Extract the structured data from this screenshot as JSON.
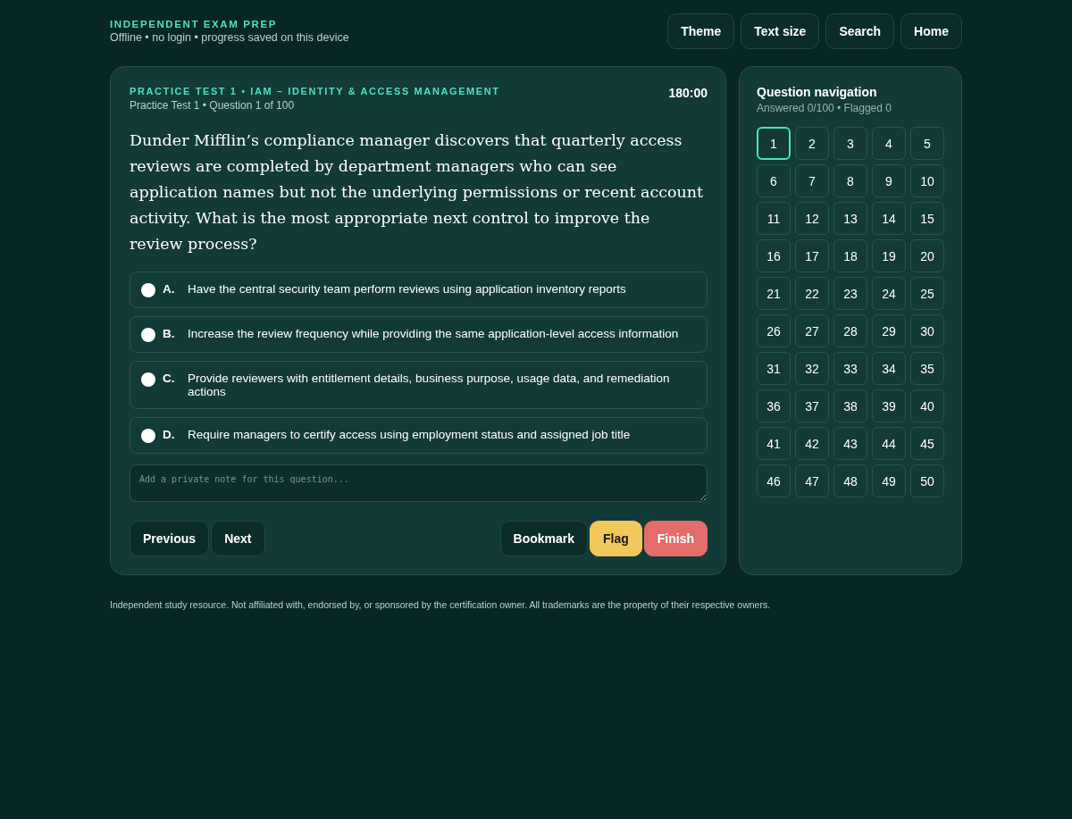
{
  "header": {
    "brand": "INDEPENDENT EXAM PREP",
    "tagline": "Offline • no login • progress saved on this device",
    "buttons": [
      "Theme",
      "Text size",
      "Search",
      "Home"
    ]
  },
  "question_card": {
    "eyebrow": "PRACTICE TEST 1 • IAM – IDENTITY & ACCESS MANAGEMENT",
    "subtitle": "Practice Test 1 • Question 1 of 100",
    "timer": "180:00",
    "question": "Dunder Mifflin’s compliance manager discovers that quarterly access reviews are completed by department managers who can see application names but not the underlying permissions or recent account activity. What is the most appropriate next control to improve the review process?",
    "options": [
      {
        "letter": "A.",
        "text": "Have the central security team perform reviews using application inventory reports",
        "selected": false
      },
      {
        "letter": "B.",
        "text": "Increase the review frequency while providing the same application-level access information",
        "selected": false
      },
      {
        "letter": "C.",
        "text": "Provide reviewers with entitlement details, business purpose, usage data, and remediation actions",
        "selected": false
      },
      {
        "letter": "D.",
        "text": "Require managers to certify access using employment status and assigned job title",
        "selected": false
      }
    ],
    "note": {
      "placeholder": "Add a private note for this question..."
    },
    "nav_buttons": [
      "Previous",
      "Next"
    ],
    "action_buttons": [
      {
        "label": "Bookmark",
        "kind": "plain"
      },
      {
        "label": "Flag",
        "kind": "flag"
      },
      {
        "label": "Finish",
        "kind": "finish"
      }
    ]
  },
  "navigation": {
    "title": "Question navigation",
    "summary": "Answered 0/100 • Flagged 0",
    "items": [
      {
        "label": "1",
        "selected": true
      },
      {
        "label": "2",
        "selected": false
      },
      {
        "label": "3",
        "selected": false
      },
      {
        "label": "4",
        "selected": false
      },
      {
        "label": "5",
        "selected": false
      },
      {
        "label": "6",
        "selected": false
      },
      {
        "label": "7",
        "selected": false
      },
      {
        "label": "8",
        "selected": false
      },
      {
        "label": "9",
        "selected": false
      },
      {
        "label": "10",
        "selected": false
      },
      {
        "label": "11",
        "selected": false
      },
      {
        "label": "12",
        "selected": false
      },
      {
        "label": "13",
        "selected": false
      },
      {
        "label": "14",
        "selected": false
      },
      {
        "label": "15",
        "selected": false
      },
      {
        "label": "16",
        "selected": false
      },
      {
        "label": "17",
        "selected": false
      },
      {
        "label": "18",
        "selected": false
      },
      {
        "label": "19",
        "selected": false
      },
      {
        "label": "20",
        "selected": false
      },
      {
        "label": "21",
        "selected": false
      },
      {
        "label": "22",
        "selected": false
      },
      {
        "label": "23",
        "selected": false
      },
      {
        "label": "24",
        "selected": false
      },
      {
        "label": "25",
        "selected": false
      },
      {
        "label": "26",
        "selected": false
      },
      {
        "label": "27",
        "selected": false
      },
      {
        "label": "28",
        "selected": false
      },
      {
        "label": "29",
        "selected": false
      },
      {
        "label": "30",
        "selected": false
      },
      {
        "label": "31",
        "selected": false
      },
      {
        "label": "32",
        "selected": false
      },
      {
        "label": "33",
        "selected": false
      },
      {
        "label": "34",
        "selected": false
      },
      {
        "label": "35",
        "selected": false
      },
      {
        "label": "36",
        "selected": false
      },
      {
        "label": "37",
        "selected": false
      },
      {
        "label": "38",
        "selected": false
      },
      {
        "label": "39",
        "selected": false
      },
      {
        "label": "40",
        "selected": false
      },
      {
        "label": "41",
        "selected": false
      },
      {
        "label": "42",
        "selected": false
      },
      {
        "label": "43",
        "selected": false
      },
      {
        "label": "44",
        "selected": false
      },
      {
        "label": "45",
        "selected": false
      },
      {
        "label": "46",
        "selected": false
      },
      {
        "label": "47",
        "selected": false
      },
      {
        "label": "48",
        "selected": false
      },
      {
        "label": "49",
        "selected": false
      },
      {
        "label": "50",
        "selected": false
      }
    ]
  },
  "footer": "Independent study resource. Not affiliated with, endorsed by, or sponsored by the certification owner. All trademarks are the property of their respective owners."
}
